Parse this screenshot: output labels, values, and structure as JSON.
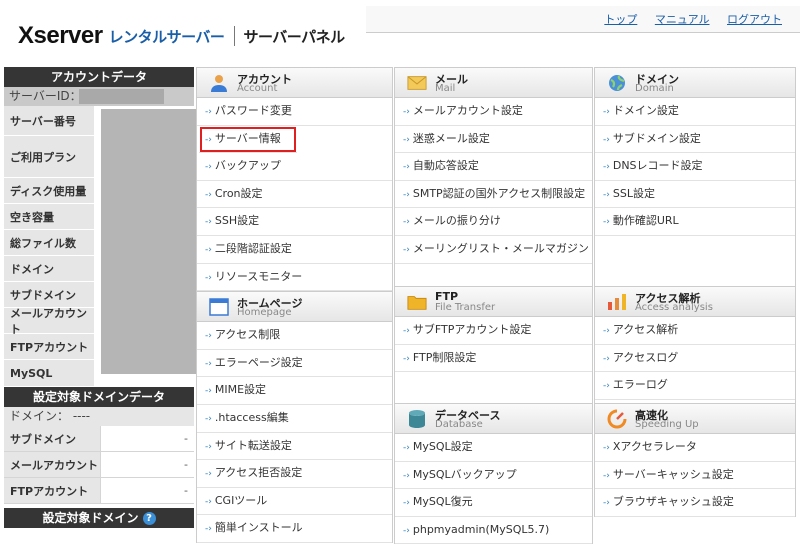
{
  "header": {
    "logo_brand": "Xserver",
    "logo_sub": "レンタルサーバー",
    "logo_panel": "サーバーパネル",
    "links": [
      "トップ",
      "マニュアル",
      "ログアウト"
    ]
  },
  "sidebar": {
    "account_title": "アカウントデータ",
    "server_id_label": "サーバーID：",
    "account_rows": [
      "サーバー番号",
      "ご利用プラン",
      "ディスク使用量",
      "空き容量",
      "総ファイル数",
      "ドメイン",
      "サブドメイン",
      "メールアカウント",
      "FTPアカウント",
      "MySQL"
    ],
    "domain_title": "設定対象ドメインデータ",
    "domain_label": "ドメイン： ----",
    "domain_rows": [
      {
        "label": "サブドメイン",
        "value": "-"
      },
      {
        "label": "メールアカウント",
        "value": "-"
      },
      {
        "label": "FTPアカウント",
        "value": "-"
      }
    ],
    "target_domain_title": "設定対象ドメイン"
  },
  "sections": {
    "account": {
      "title": "アカウント",
      "subtitle": "Account",
      "items": [
        "パスワード変更",
        "サーバー情報",
        "バックアップ",
        "Cron設定",
        "SSH設定",
        "二段階認証設定",
        "リソースモニター"
      ]
    },
    "mail": {
      "title": "メール",
      "subtitle": "Mail",
      "items": [
        "メールアカウント設定",
        "迷惑メール設定",
        "自動応答設定",
        "SMTP認証の国外アクセス制限設定",
        "メールの振り分け",
        "メーリングリスト・メールマガジン"
      ]
    },
    "domain": {
      "title": "ドメイン",
      "subtitle": "Domain",
      "items": [
        "ドメイン設定",
        "サブドメイン設定",
        "DNSレコード設定",
        "SSL設定",
        "動作確認URL"
      ]
    },
    "homepage": {
      "title": "ホームページ",
      "subtitle": "Homepage",
      "items": [
        "アクセス制限",
        "エラーページ設定",
        "MIME設定",
        ".htaccess編集",
        "サイト転送設定",
        "アクセス拒否設定",
        "CGIツール",
        "簡単インストール"
      ]
    },
    "ftp": {
      "title": "FTP",
      "subtitle": "File Transfer",
      "items": [
        "サブFTPアカウント設定",
        "FTP制限設定"
      ]
    },
    "access": {
      "title": "アクセス解析",
      "subtitle": "Access analysis",
      "items": [
        "アクセス解析",
        "アクセスログ",
        "エラーログ"
      ]
    },
    "database": {
      "title": "データベース",
      "subtitle": "Database",
      "items": [
        "MySQL設定",
        "MySQLバックアップ",
        "MySQL復元",
        "phpmyadmin(MySQL5.7)"
      ]
    },
    "speed": {
      "title": "高速化",
      "subtitle": "Speeding Up",
      "items": [
        "Xアクセラレータ",
        "サーバーキャッシュ設定",
        "ブラウザキャッシュ設定"
      ]
    }
  },
  "colors": {
    "dark_header": "#353535",
    "link": "#1a5ea8",
    "highlight": "#e02020",
    "help": "#3a8fd6"
  }
}
